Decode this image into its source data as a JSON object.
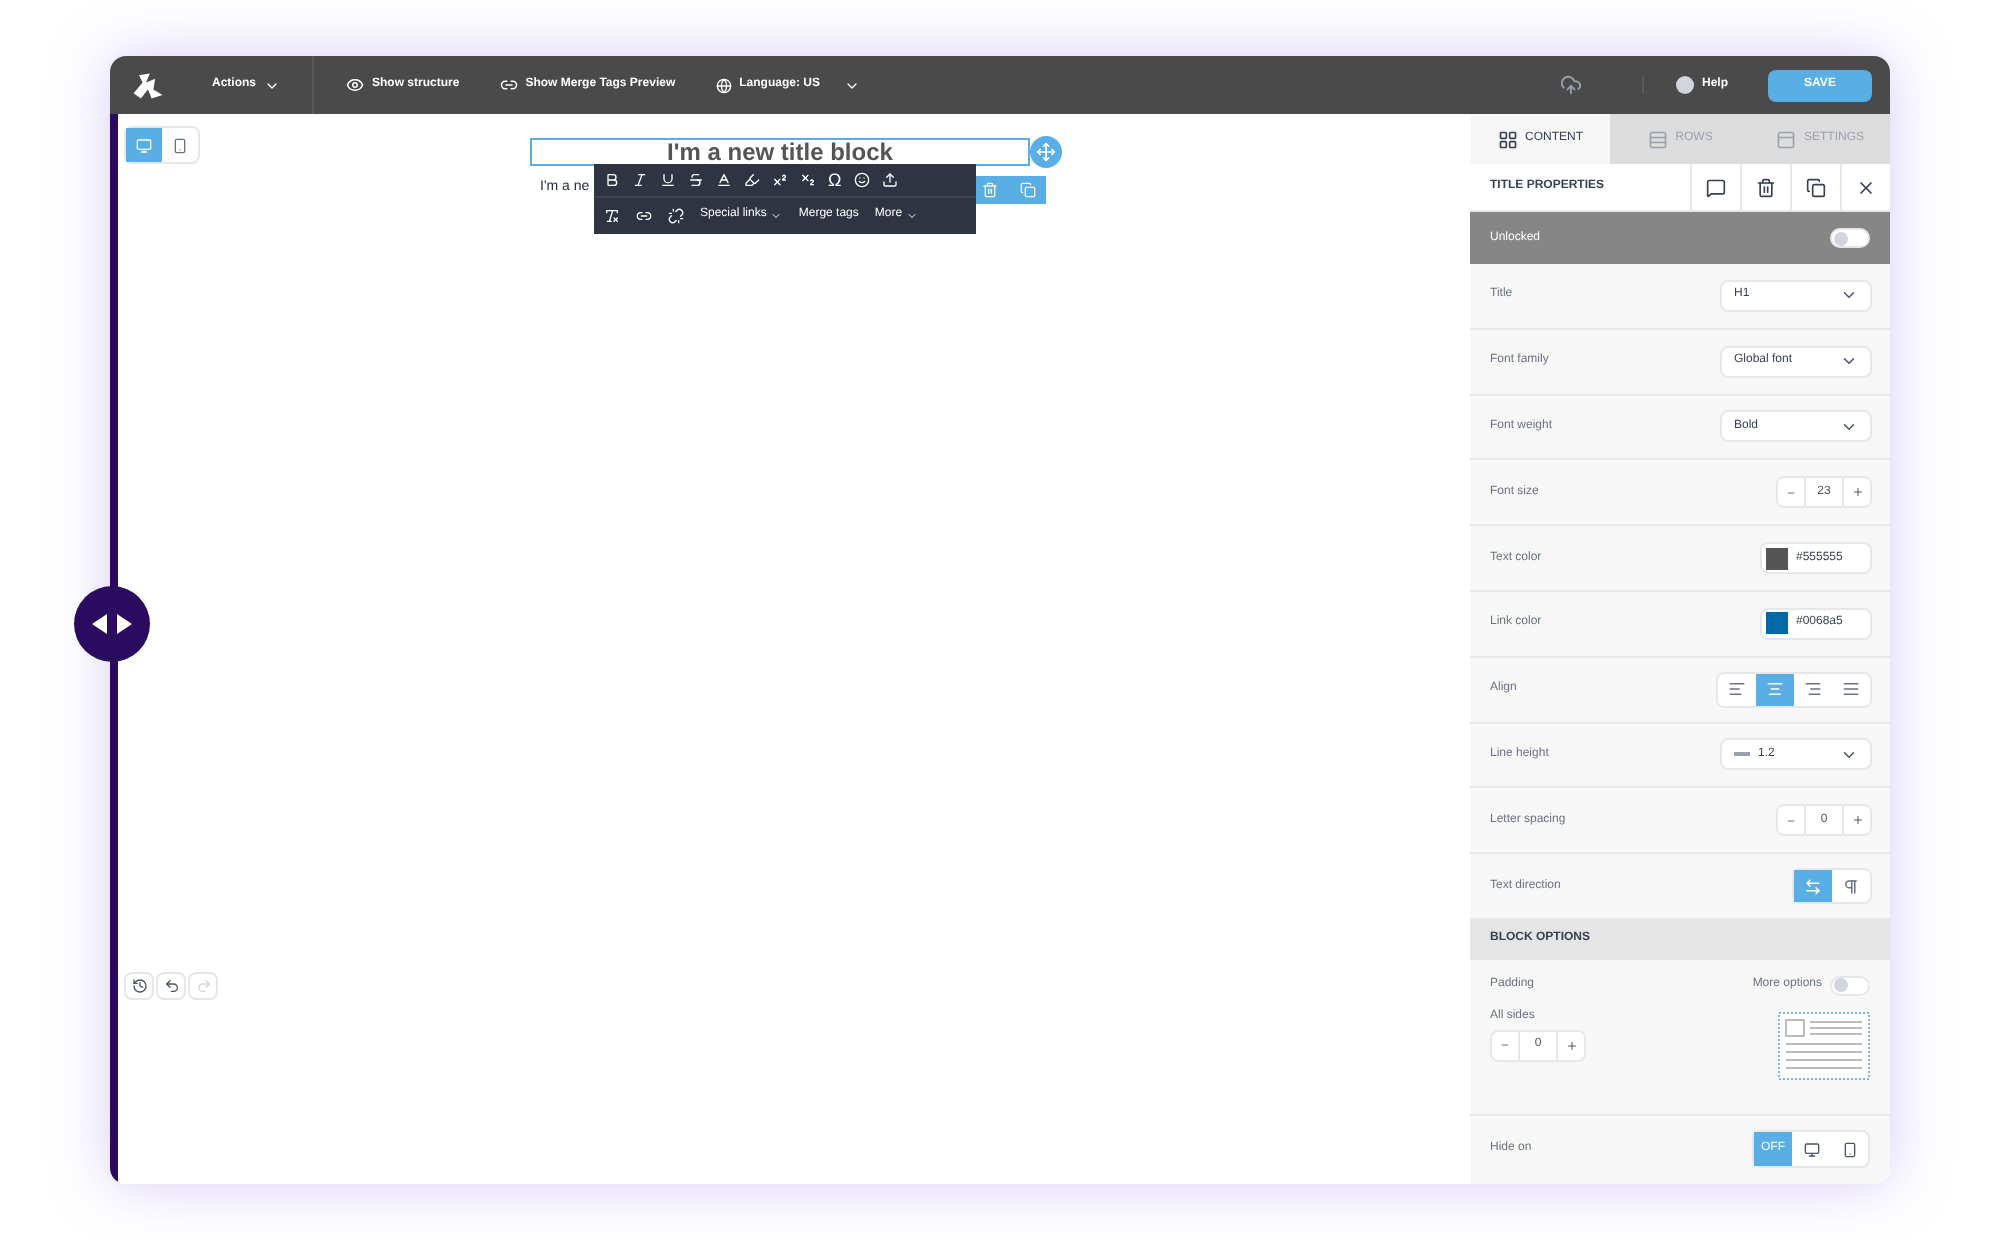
{
  "topbar": {
    "actions": "Actions",
    "show_structure": "Show structure",
    "merge_tags_preview": "Show Merge Tags Preview",
    "language": "Language: US",
    "help": "Help",
    "save": "SAVE"
  },
  "view_toggle": [
    {
      "kind": "desktop",
      "selected": true
    },
    {
      "kind": "mobile",
      "selected": false
    }
  ],
  "canvas": {
    "title_block": "I'm a new title block",
    "paragraph": "I'm a ne"
  },
  "format_toolbar": {
    "omega": "Ω",
    "special_links": "Special links",
    "merge_tags": "Merge tags",
    "more": "More"
  },
  "panel": {
    "tabs": [
      {
        "kind": "content",
        "label": "CONTENT",
        "selected": true
      },
      {
        "kind": "rows",
        "label": "ROWS",
        "selected": false
      },
      {
        "kind": "settings",
        "label": "SETTINGS",
        "selected": false
      }
    ],
    "header": "TITLE PROPERTIES",
    "lock": {
      "label": "Unlocked",
      "on": false
    },
    "properties": [
      {
        "kind": "select",
        "label": "Title",
        "value": "H1"
      },
      {
        "kind": "select",
        "label": "Font family",
        "value": "Global font"
      },
      {
        "kind": "select",
        "label": "Font weight",
        "value": "Bold"
      },
      {
        "kind": "stepper",
        "label": "Font size",
        "value": "23"
      },
      {
        "kind": "color",
        "label": "Text color",
        "value": "#555555",
        "color": "#555555"
      },
      {
        "kind": "color",
        "label": "Link color",
        "value": "#0068a5",
        "color": "#0068a5"
      },
      {
        "kind": "align",
        "label": "Align",
        "options": [
          {
            "kind": "left",
            "selected": false
          },
          {
            "kind": "center",
            "selected": true
          },
          {
            "kind": "right",
            "selected": false
          },
          {
            "kind": "justify",
            "selected": false
          }
        ]
      },
      {
        "kind": "lineheight",
        "label": "Line height",
        "value": "1.2"
      },
      {
        "kind": "stepper",
        "label": "Letter spacing",
        "value": "0"
      },
      {
        "kind": "direction",
        "label": "Text direction",
        "options": [
          {
            "kind": "ltr",
            "selected": true
          },
          {
            "kind": "rtl",
            "selected": false
          }
        ]
      }
    ],
    "block_options": {
      "header": "BLOCK OPTIONS",
      "padding": "Padding",
      "more_options": {
        "label": "More options",
        "on": false
      },
      "all_sides": "All sides",
      "all_sides_value": "0",
      "hide_on": {
        "label": "Hide on",
        "options": [
          {
            "kind": "off",
            "label": "OFF",
            "selected": true
          },
          {
            "kind": "desktop",
            "selected": false
          },
          {
            "kind": "mobile",
            "selected": false
          }
        ]
      }
    }
  }
}
